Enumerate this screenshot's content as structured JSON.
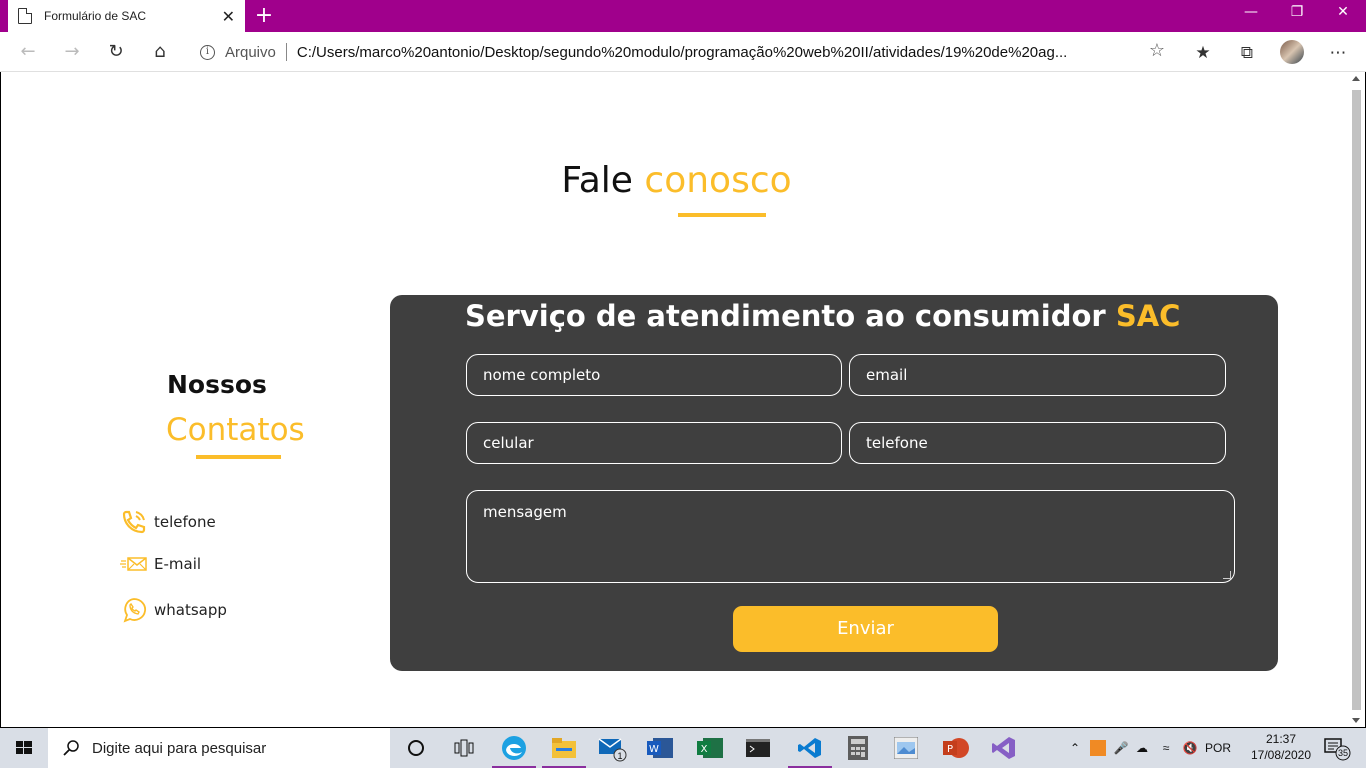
{
  "browser": {
    "tab_title": "Formulário de SAC",
    "tab_close": "✕",
    "new_tab": "+",
    "address_prefix": "Arquivo",
    "url": "C:/Users/marco%20antonio/Desktop/segundo%20modulo/programação%20web%20II/atividades/19%20de%20ag..."
  },
  "page": {
    "heading_main": "Fale",
    "heading_accent": "conosco",
    "contacts_title_1": "Nossos",
    "contacts_title_2": "Contatos",
    "contacts": [
      {
        "label": "telefone",
        "icon": "phone-icon"
      },
      {
        "label": "E-mail",
        "icon": "email-icon"
      },
      {
        "label": "whatsapp",
        "icon": "whatsapp-icon"
      }
    ],
    "form": {
      "title_main": "Serviço de atendimento ao consumidor",
      "title_accent": "SAC",
      "fields": {
        "nome": "nome completo",
        "email": "email",
        "celular": "celular",
        "telefone": "telefone",
        "mensagem": "mensagem"
      },
      "submit_label": "Enviar"
    }
  },
  "taskbar": {
    "search_placeholder": "Digite aqui para pesquisar",
    "language": "POR",
    "time": "21:37",
    "date": "17/08/2020",
    "mail_badge": "1",
    "notifications": "35"
  },
  "colors": {
    "accent": "#fbbd2a",
    "panel": "#3f3f3f",
    "titlebar": "#a0008c"
  }
}
